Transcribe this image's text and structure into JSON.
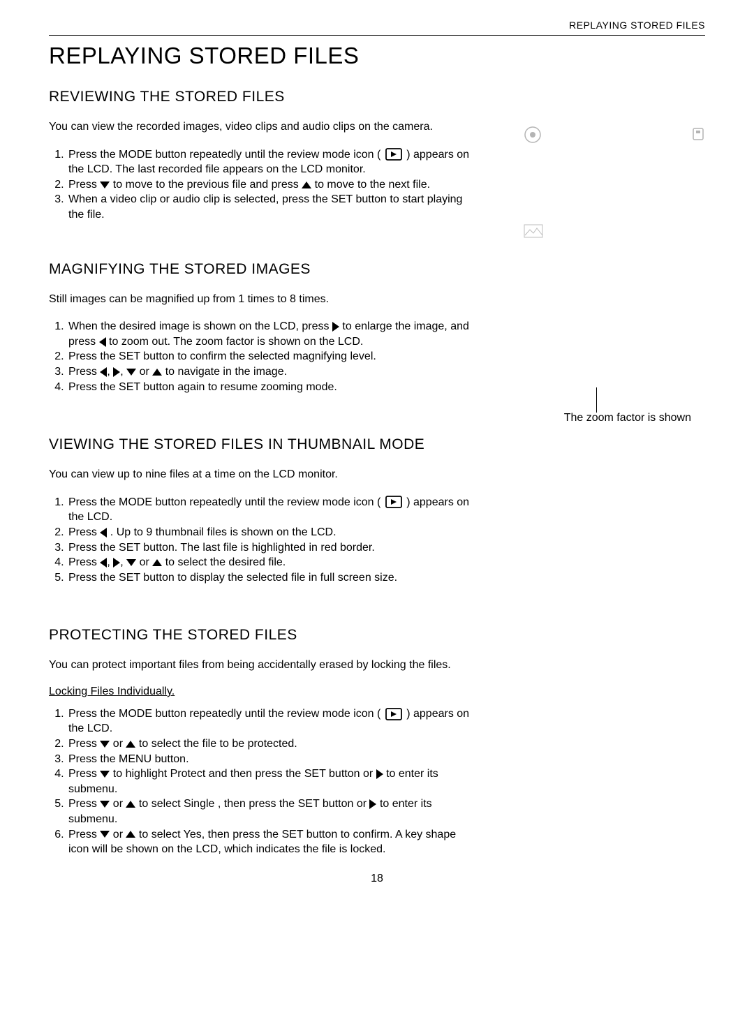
{
  "running_head": "REPLAYING STORED FILES",
  "page_title": "REPLAYING STORED FILES",
  "page_number": "18",
  "zoom_caption": "The zoom factor is shown",
  "sections": {
    "reviewing": {
      "heading": "REVIEWING THE STORED FILES",
      "lead": "You can view the recorded images, video clips and audio clips on the camera.",
      "steps": {
        "s1a": "Press the MODE button repeatedly until the review mode icon (",
        "s1b": ") appears on the LCD. The last recorded file appears on the LCD monitor.",
        "s2a": "Press ",
        "s2b": " to move to the previous file and press ",
        "s2c": " to move to the next file.",
        "s3": "When a video clip or audio clip is selected, press the SET button to start playing the file."
      }
    },
    "magnifying": {
      "heading": "MAGNIFYING THE STORED IMAGES",
      "lead": "Still images can be magnified up from 1 times to 8 times.",
      "steps": {
        "s1a": "When the desired image is shown on the LCD, press ",
        "s1b": " to enlarge the image, and press ",
        "s1c": " to zoom out. The zoom factor is shown on the LCD.",
        "s2": "Press the SET button to confirm the selected magnifying level.",
        "s3a": "Press ",
        "s3b": " or ",
        "s3c": " to navigate in the image.",
        "s4": "Press the SET button again to resume zooming mode."
      }
    },
    "thumbnail": {
      "heading": "VIEWING THE STORED FILES IN THUMBNAIL MODE",
      "lead": "You can view up to nine files at a time on the LCD monitor.",
      "steps": {
        "s1a": "Press the MODE button repeatedly until the review mode icon (",
        "s1b": ") appears on the LCD.",
        "s2a": "Press ",
        "s2b": " . Up to 9 thumbnail files is shown on the LCD.",
        "s3": "Press the SET button. The last file is highlighted in red border.",
        "s4a": "Press ",
        "s4b": " or ",
        "s4c": " to select the desired file.",
        "s5": "Press the SET button to display the selected file in full screen size."
      }
    },
    "protecting": {
      "heading": "PROTECTING THE STORED FILES",
      "lead": "You can protect important files from being accidentally erased by locking the files.",
      "subhead": "Locking Files Individually.   ",
      "steps": {
        "s1a": "Press the MODE button repeatedly until the review mode icon (",
        "s1b": ") appears on the LCD.",
        "s2a": "Press ",
        "s2b": " or ",
        "s2c": " to select the file to be protected.",
        "s3": "Press the MENU button.",
        "s4a": "Press ",
        "s4b": " to highlight Protect  and then press the SET button or ",
        "s4c": " to enter its submenu.",
        "s5a": "Press ",
        "s5b": " or ",
        "s5c": " to select Single , then press the SET button or ",
        "s5d": " to enter its submenu.",
        "s6a": "Press ",
        "s6b": " or ",
        "s6c": " to select Yes, then press the SET button to confirm. A key shape icon will be shown on the LCD, which indicates the file is locked."
      }
    }
  }
}
